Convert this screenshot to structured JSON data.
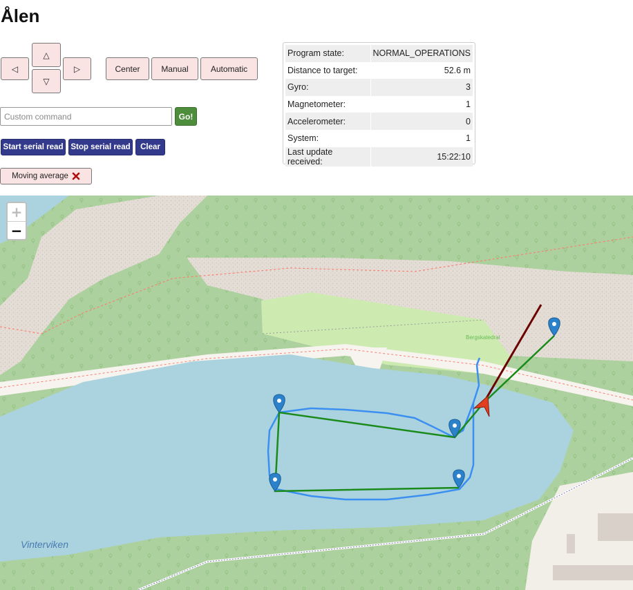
{
  "title": "Ålen",
  "controls": {
    "left": "◁",
    "up": "△",
    "down": "▽",
    "right": "▷",
    "center": "Center",
    "manual": "Manual",
    "automatic": "Automatic"
  },
  "command": {
    "placeholder": "Custom command",
    "go": "Go!"
  },
  "serial": {
    "start": "Start serial read",
    "stop": "Stop serial read",
    "clear": "Clear"
  },
  "moving_average": {
    "label": "Moving average",
    "icon": "close-x-icon"
  },
  "status": [
    {
      "label": "Program state:",
      "value": "NORMAL_OPERATIONS"
    },
    {
      "label": "Distance to target:",
      "value": "52.6 m"
    },
    {
      "label": "Gyro:",
      "value": "3"
    },
    {
      "label": "Magnetometer:",
      "value": "1"
    },
    {
      "label": "Accelerometer:",
      "value": "0"
    },
    {
      "label": "System:",
      "value": "1"
    },
    {
      "label": "Last update received:",
      "value": "15:22:10"
    }
  ],
  "map": {
    "zoom_in": "+",
    "zoom_out": "−",
    "labels": {
      "lake": "Vinterviken",
      "place": "Bergskatedral"
    },
    "colors": {
      "water": "#aad3df",
      "grass": "#add19e",
      "path_blue": "#3b8ff0",
      "route_green": "#1a8a1a",
      "heading": "#6b0000",
      "arrow": "#e04020"
    }
  }
}
